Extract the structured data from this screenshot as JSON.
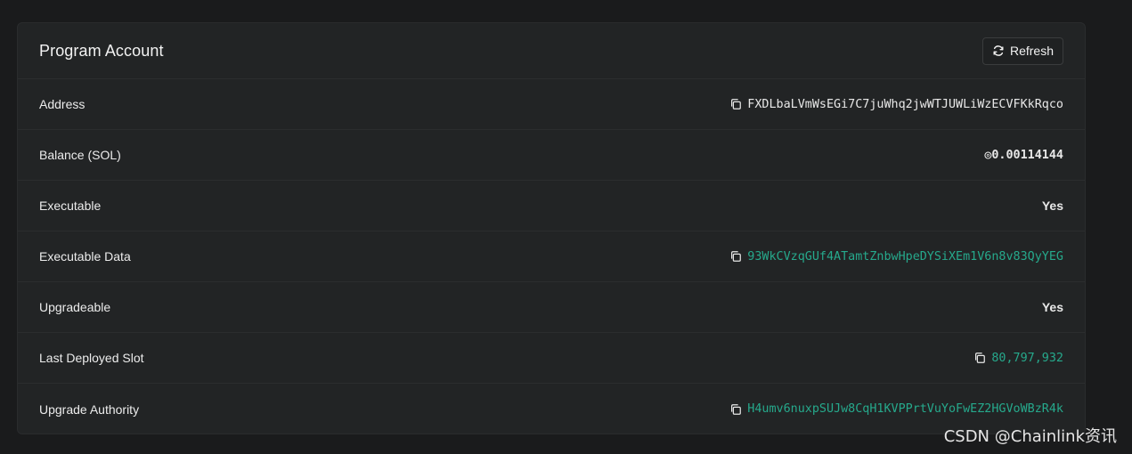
{
  "card": {
    "title": "Program Account",
    "refresh_label": "Refresh"
  },
  "rows": [
    {
      "label": "Address",
      "value": "FXDLbaLVmWsEGi7C7juWhq2jwWTJUWLiWzECVFKkRqco",
      "copyable": true,
      "link": false
    },
    {
      "label": "Balance (SOL)",
      "value": "◎0.00114144",
      "copyable": false,
      "link": false
    },
    {
      "label": "Executable",
      "value": "Yes",
      "copyable": false,
      "link": false
    },
    {
      "label": "Executable Data",
      "value": "93WkCVzqGUf4ATamtZnbwHpeDYSiXEm1V6n8v83QyYEG",
      "copyable": true,
      "link": true
    },
    {
      "label": "Upgradeable",
      "value": "Yes",
      "copyable": false,
      "link": false
    },
    {
      "label": "Last Deployed Slot",
      "value": "80,797,932",
      "copyable": true,
      "link": true
    },
    {
      "label": "Upgrade Authority",
      "value": "H4umv6nuxpSUJw8CqH1KVPPrtVuYoFwEZ2HGVoWBzR4k",
      "copyable": true,
      "link": true
    }
  ],
  "colors": {
    "background": "#1a1b1c",
    "card": "#222425",
    "link_green": "#26a98c",
    "text": "#ececec"
  },
  "icons": {
    "refresh": "refresh-icon",
    "copy": "copy-icon"
  },
  "watermark": "CSDN @Chainlink资讯"
}
